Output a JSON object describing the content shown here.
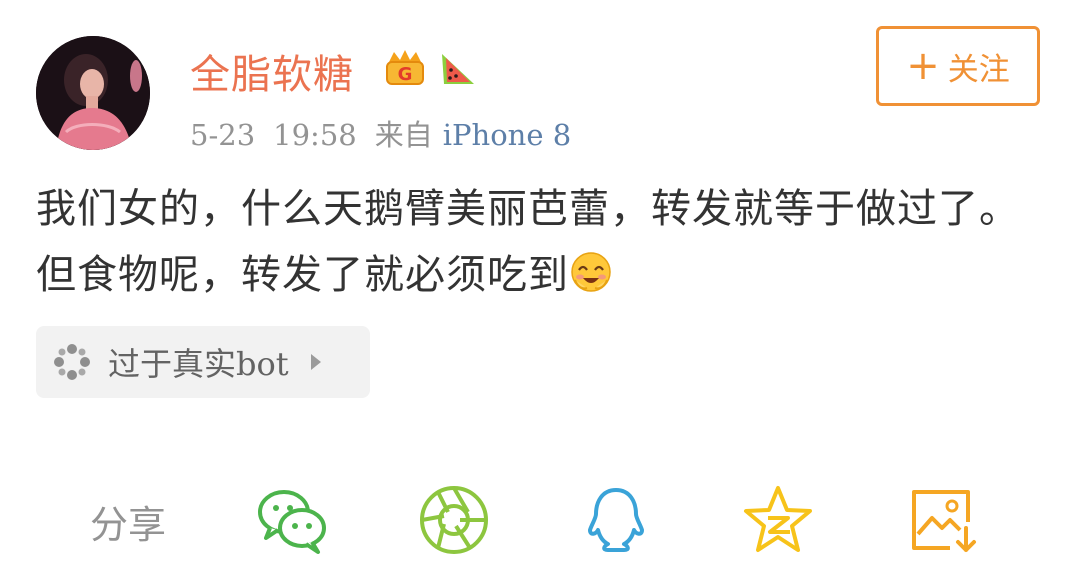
{
  "post": {
    "username": "全脂软糖",
    "date": "5-23",
    "time": "19:58",
    "source_prefix": "来自",
    "source": "iPhone 8",
    "text": "我们女的，什么天鹅臂美丽芭蕾，转发就等于做过了。但食物呢，转发了就必须吃到",
    "follow_label": "关注",
    "follow_plus": "+"
  },
  "tag": {
    "label": "过于真实bot"
  },
  "share": {
    "label": "分享",
    "targets": [
      "wechat-icon",
      "moments-icon",
      "qq-icon",
      "qzone-icon",
      "save-image-icon"
    ]
  },
  "colors": {
    "username": "#eb7350",
    "follow": "#f09135",
    "source": "#5d7fa8",
    "meta": "#939393",
    "wechat": "#4cb44c",
    "moments": "#8dc63f",
    "qq": "#3aa3d8",
    "qzone": "#f7c31a",
    "save": "#f5a623"
  },
  "icons": {
    "avatar": "avatar-photo",
    "badge_crown": "crown-badge-icon",
    "badge_watermelon": "watermelon-badge-icon",
    "emoji": "blushing-smile-emoji",
    "tag": "topic-icon"
  }
}
